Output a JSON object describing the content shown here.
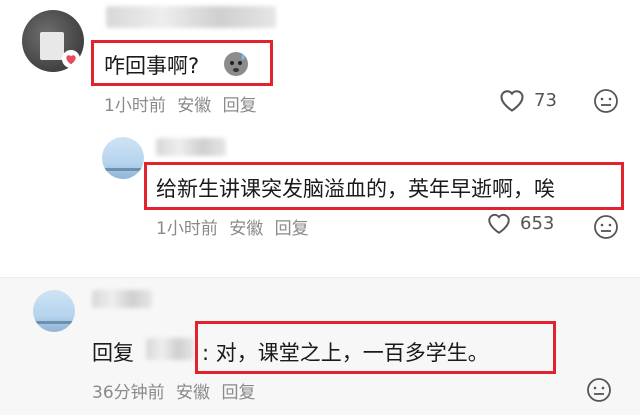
{
  "comment1": {
    "text": "咋回事啊?",
    "emoji": "cold-sweat-face",
    "meta": {
      "time": "1小时前",
      "location": "安徽",
      "reply": "回复"
    },
    "likes": "73"
  },
  "comment2": {
    "text": "给新生讲课突发脑溢血的，英年早逝啊，唉",
    "meta": {
      "time": "1小时前",
      "location": "安徽",
      "reply": "回复"
    },
    "likes": "653"
  },
  "comment3": {
    "reply_prefix": "回复",
    "text": ": 对，课堂之上，一百多学生。",
    "meta": {
      "time": "36分钟前",
      "location": "安徽",
      "reply": "回复"
    }
  },
  "colors": {
    "highlight": "#e2222d",
    "meta": "#8a8a8a",
    "thread_bg": "#f7f7f7"
  },
  "icons": [
    "heart-outline-icon",
    "emoji-reaction-icon",
    "heart-badge-icon"
  ]
}
